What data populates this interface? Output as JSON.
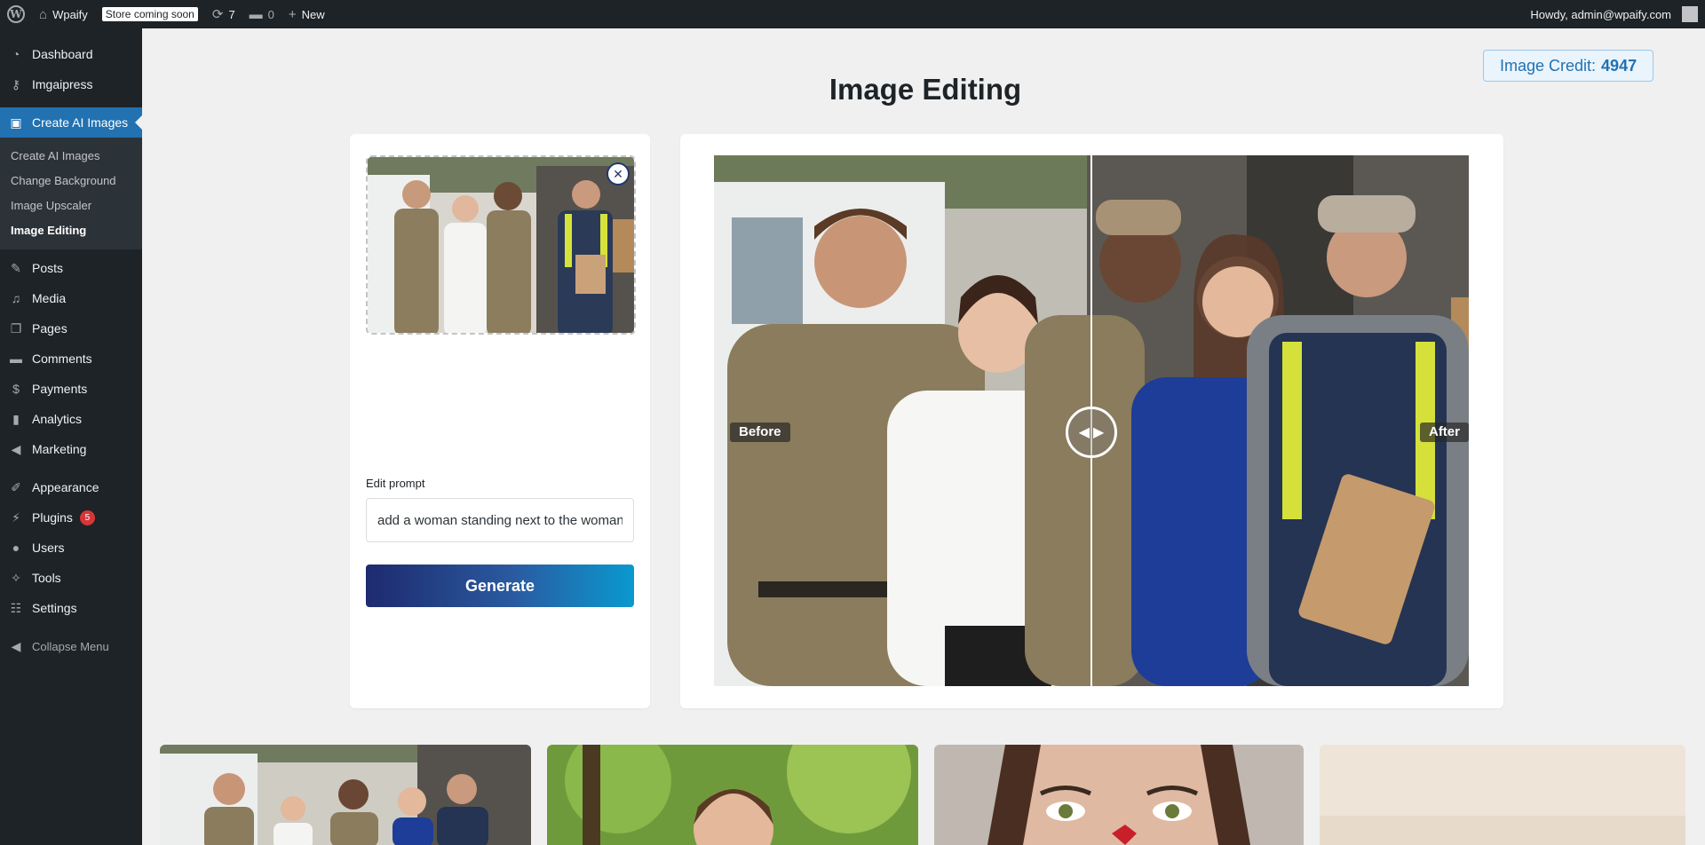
{
  "adminbar": {
    "site_name": "Wpaify",
    "store_badge": "Store coming soon",
    "updates_count": "7",
    "comments_count": "0",
    "new_label": "New",
    "howdy": "Howdy, admin@wpaify.com"
  },
  "sidebar": {
    "dashboard": "Dashboard",
    "imgaipress": "Imgaipress",
    "create_ai_images": "Create AI Images",
    "submenu": [
      "Create AI Images",
      "Change Background",
      "Image Upscaler",
      "Image Editing"
    ],
    "posts": "Posts",
    "media": "Media",
    "pages": "Pages",
    "comments": "Comments",
    "payments": "Payments",
    "analytics": "Analytics",
    "marketing": "Marketing",
    "appearance": "Appearance",
    "plugins": "Plugins",
    "plugins_badge": "5",
    "users": "Users",
    "tools": "Tools",
    "settings": "Settings",
    "collapse": "Collapse Menu"
  },
  "main": {
    "credit_label": "Image Credit:",
    "credit_value": "4947",
    "title": "Image Editing",
    "prompt_label": "Edit prompt",
    "prompt_value": "add a woman standing next to the woman",
    "generate_label": "Generate",
    "before_label": "Before",
    "after_label": "After"
  },
  "colors": {
    "admin_dark": "#1d2327",
    "accent": "#2271b1",
    "gradient_start": "#1e2a6e",
    "gradient_end": "#0a99cf"
  }
}
